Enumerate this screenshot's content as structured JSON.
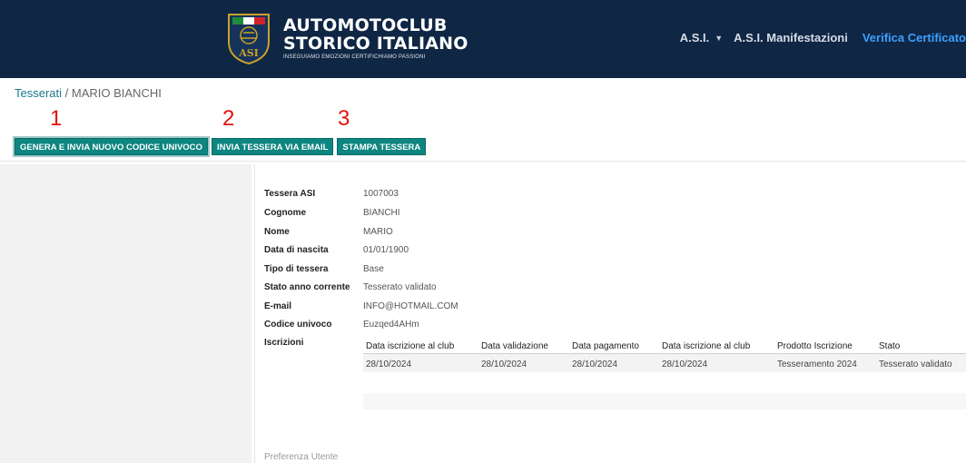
{
  "header": {
    "logo": {
      "line1": "AUTOMOTOCLUB",
      "line2": "STORICO ITALIANO",
      "tagline": "INSEGUIAMO EMOZIONI CERTIFICHIAMO PASSIONI",
      "shield_text": "ASI"
    },
    "nav": [
      {
        "label": "A.S.I.",
        "dropdown": true
      },
      {
        "label": "A.S.I. Manifestazioni"
      },
      {
        "label": "Verifica Certificato"
      }
    ],
    "colors": {
      "background": "#0f2644",
      "accent": "#3ea0ff"
    }
  },
  "breadcrumb": {
    "link": "Tesserati",
    "separator": " / ",
    "current": "MARIO BIANCHI"
  },
  "annotations": [
    "1",
    "2",
    "3"
  ],
  "actions": {
    "generate": "GENERA E INVIA NUOVO CODICE UNIVOCO",
    "email": "INVIA TESSERA VIA EMAIL",
    "print": "STAMPA TESSERA",
    "color": "#0d8580"
  },
  "details": [
    {
      "label": "Tessera ASI",
      "value": "1007003"
    },
    {
      "label": "Cognome",
      "value": "BIANCHI"
    },
    {
      "label": "Nome",
      "value": "MARIO"
    },
    {
      "label": "Data di nascita",
      "value": "01/01/1900"
    },
    {
      "label": "Tipo di tessera",
      "value": "Base"
    },
    {
      "label": "Stato anno corrente",
      "value": "Tesserato validato"
    },
    {
      "label": "E-mail",
      "value": "INFO@HOTMAIL.COM"
    },
    {
      "label": "Codice univoco",
      "value": "Euzqed4AHm"
    },
    {
      "label": "Iscrizioni",
      "value": ""
    }
  ],
  "iscrizioni": {
    "columns": [
      "Data iscrizione al club",
      "Data validazione",
      "Data pagamento",
      "Data iscrizione al club",
      "Prodotto Iscrizione",
      "Stato"
    ],
    "rows": [
      [
        "28/10/2024",
        "28/10/2024",
        "28/10/2024",
        "28/10/2024",
        "Tesseramento 2024",
        "Tesserato validato"
      ]
    ]
  },
  "footer": {
    "preferences": "Preferenza Utente"
  }
}
